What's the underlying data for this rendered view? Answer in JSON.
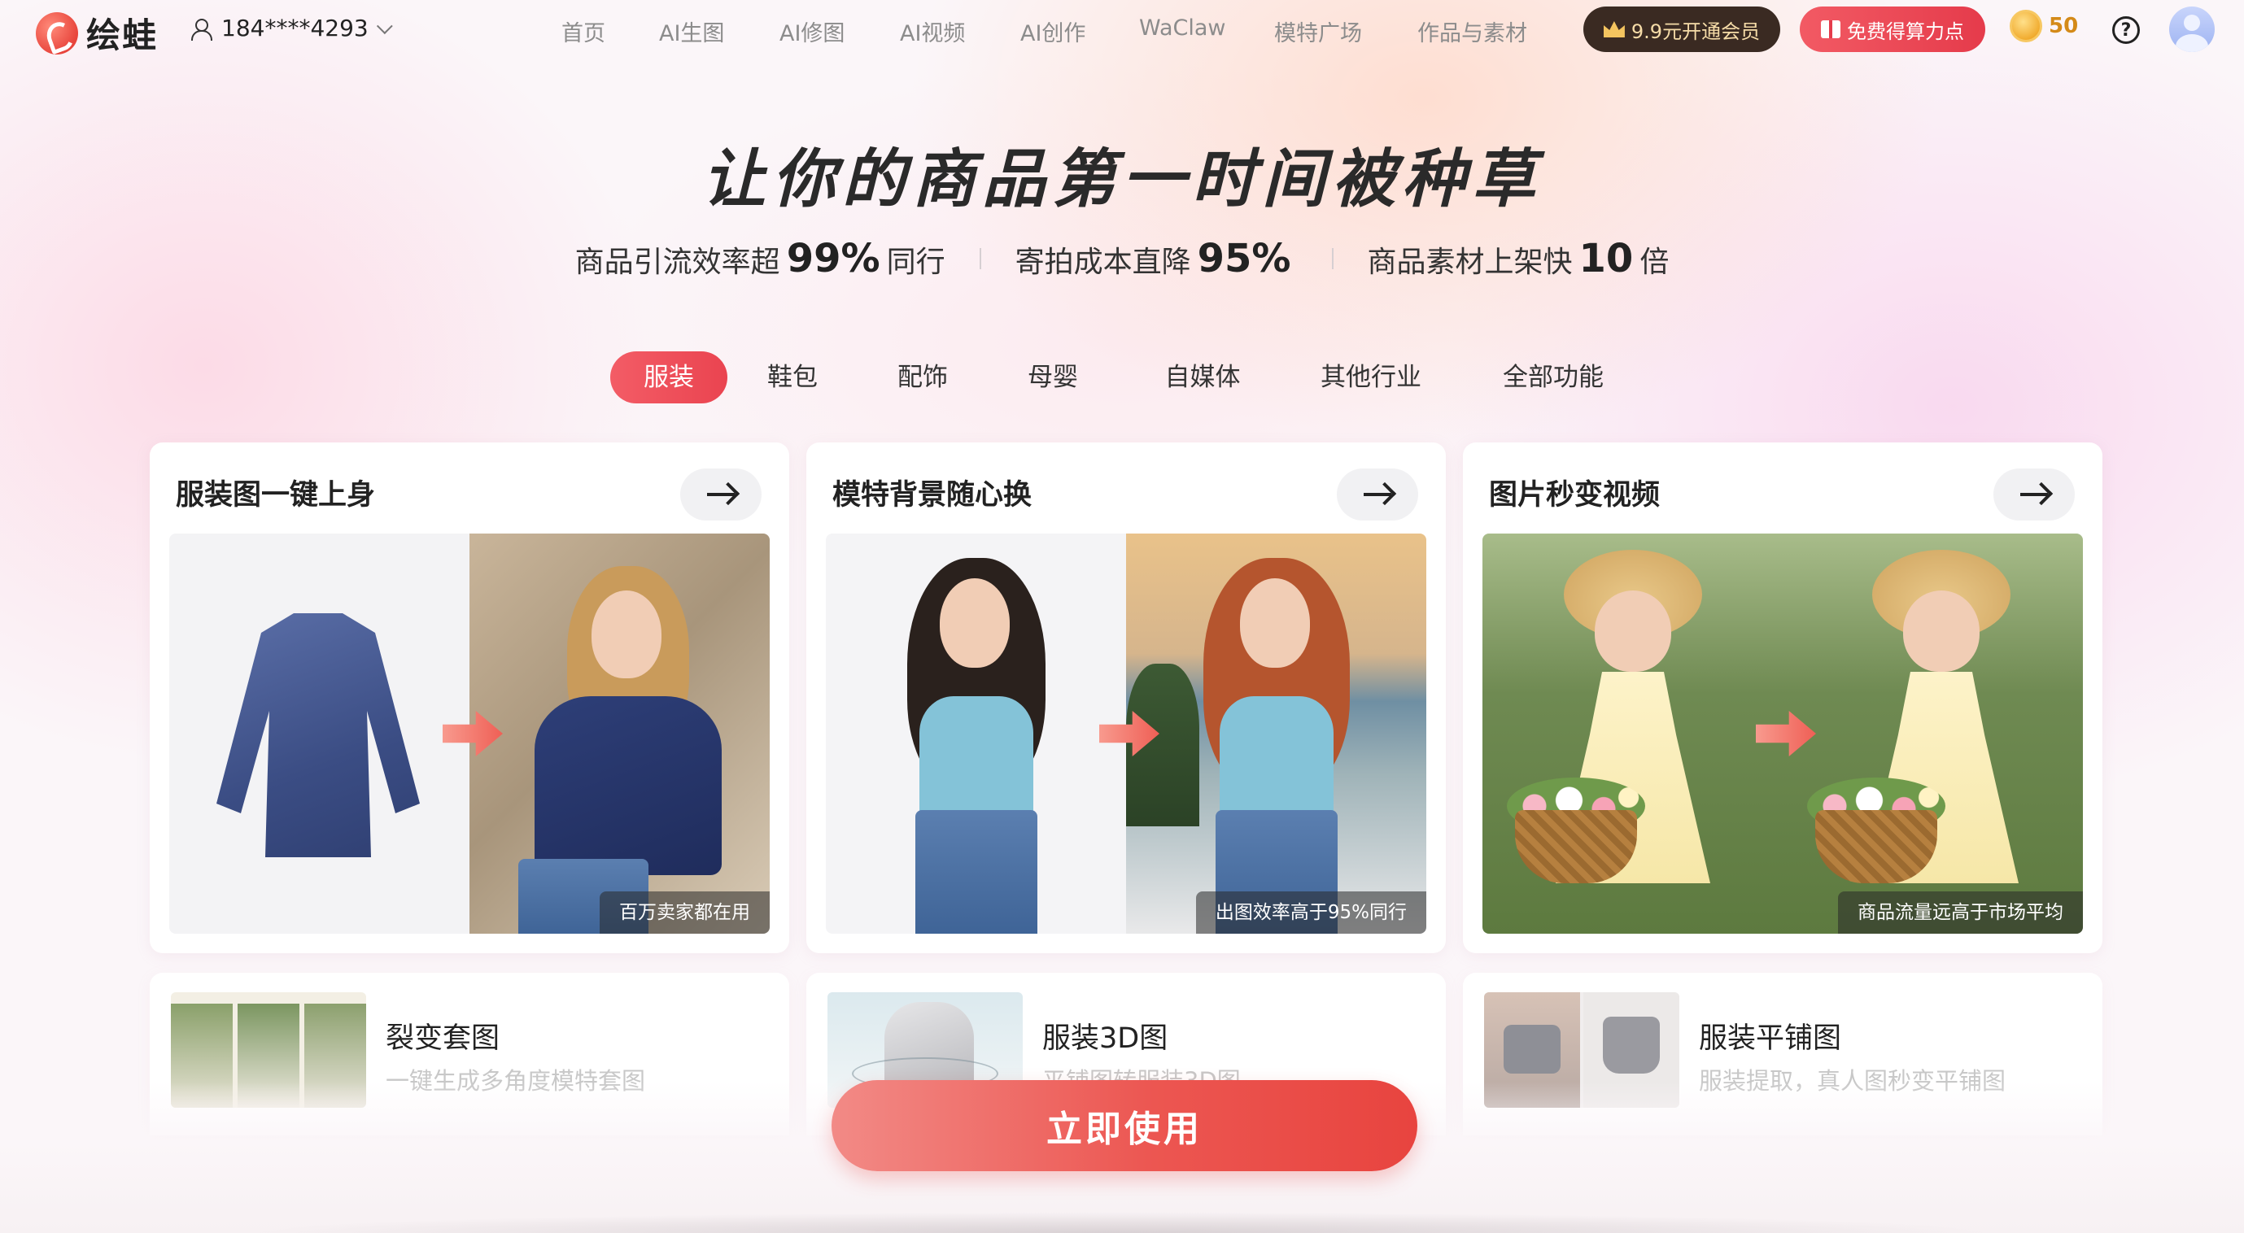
{
  "header": {
    "logo_text": "绘蛙",
    "account": "184****4293",
    "nav": [
      "首页",
      "AI生图",
      "AI修图",
      "AI视频",
      "AI创作",
      "WaClaw",
      "模特广场",
      "作品与素材"
    ],
    "vip_label": "9.9元开通会员",
    "free_label": "免费得算力点",
    "coins": "50",
    "help_label": "?"
  },
  "hero": {
    "title": "让你的商品第一时间被种草",
    "stats": [
      {
        "prefix": "商品引流效率超",
        "value": "99%",
        "suffix": "同行"
      },
      {
        "prefix": "寄拍成本直降",
        "value": "95%",
        "suffix": ""
      },
      {
        "prefix": "商品素材上架快",
        "value": "10",
        "suffix": "倍"
      }
    ]
  },
  "tabs": {
    "items": [
      "服装",
      "鞋包",
      "配饰",
      "母婴",
      "自媒体",
      "其他行业",
      "全部功能"
    ],
    "active": "服装"
  },
  "cards": [
    {
      "title": "服装图一键上身",
      "caption": "百万卖家都在用"
    },
    {
      "title": "模特背景随心换",
      "caption": "出图效率高于95%同行"
    },
    {
      "title": "图片秒变视频",
      "caption": "商品流量远高于市场平均"
    }
  ],
  "mini_cards": [
    {
      "title": "裂变套图",
      "desc": "一键生成多角度模特套图"
    },
    {
      "title": "服装3D图",
      "desc": "平铺图转服装3D图"
    },
    {
      "title": "服装平铺图",
      "desc": "服装提取，真人图秒变平铺图"
    }
  ],
  "cta": {
    "label": "立即使用"
  },
  "colors": {
    "accent": "#EA4450",
    "vip_bg": "#3A2A22",
    "coin": "#F0A92B"
  }
}
